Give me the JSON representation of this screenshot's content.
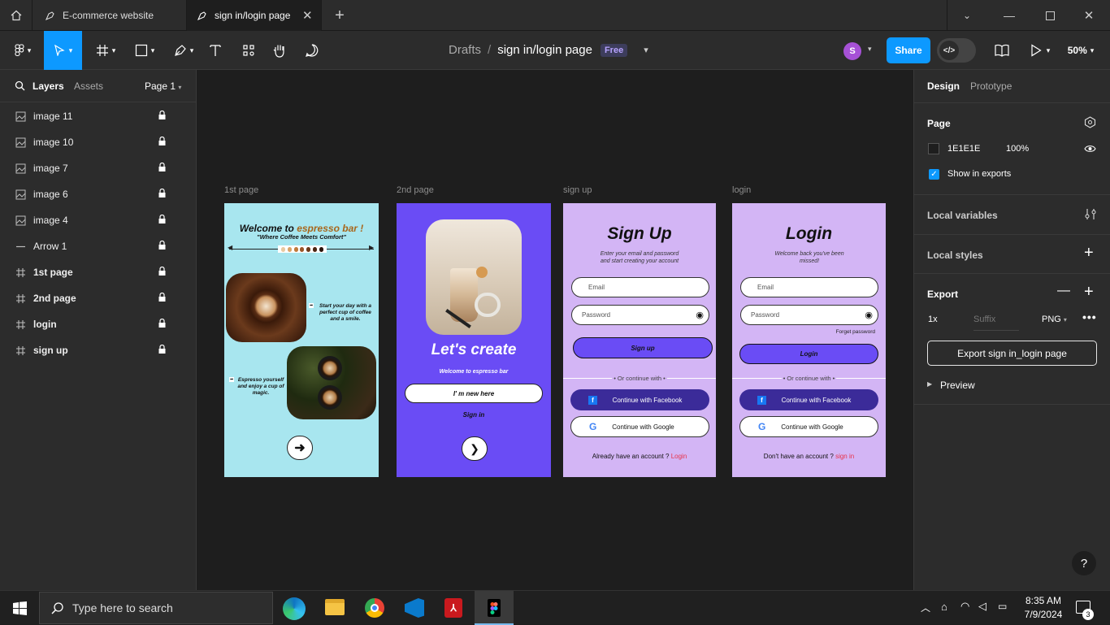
{
  "tabs": [
    {
      "label": "E-commerce website"
    },
    {
      "label": "sign in/login page"
    }
  ],
  "toolbar": {
    "breadcrumb_root": "Drafts",
    "breadcrumb_sep": "/",
    "file_name": "sign in/login page",
    "plan_badge": "Free",
    "avatar_letter": "S",
    "share_label": "Share",
    "zoom": "50%"
  },
  "left_panel": {
    "tab_layers": "Layers",
    "tab_assets": "Assets",
    "page_selector": "Page 1",
    "layers": [
      {
        "name": "image 11",
        "type": "image"
      },
      {
        "name": "image 10",
        "type": "image"
      },
      {
        "name": "image 7",
        "type": "image"
      },
      {
        "name": "image 6",
        "type": "image"
      },
      {
        "name": "image 4",
        "type": "image"
      },
      {
        "name": "Arrow 1",
        "type": "line"
      },
      {
        "name": "1st page",
        "type": "frame"
      },
      {
        "name": "2nd page",
        "type": "frame"
      },
      {
        "name": "login",
        "type": "frame"
      },
      {
        "name": "sign up",
        "type": "frame"
      }
    ]
  },
  "right_panel": {
    "tab_design": "Design",
    "tab_prototype": "Prototype",
    "page_title": "Page",
    "page_color": "1E1E1E",
    "page_opacity": "100%",
    "show_exports": "Show in exports",
    "local_variables": "Local variables",
    "local_styles": "Local styles",
    "export_title": "Export",
    "export_scale": "1x",
    "export_suffix_placeholder": "Suffix",
    "export_format": "PNG",
    "export_button": "Export sign in_login page",
    "preview": "Preview"
  },
  "frames": {
    "first": {
      "label": "1st page",
      "welcome": "Welcome to ",
      "brand": "espresso bar !",
      "tagline": "\"Where Coffee Meets Comfort\"",
      "text1": "Start your day with a perfect cup of coffee and a smile.",
      "text2": "Espresso yourself and enjoy a cup of magic."
    },
    "second": {
      "label": "2nd page",
      "heading": "Let's create",
      "subtitle": "Welcome to espresso bar",
      "new_btn": "I' m new here",
      "sign_in": "Sign in"
    },
    "signup": {
      "label": "sign up",
      "heading": "Sign Up",
      "subtitle": "Enter your email and password and start creating your account",
      "email_placeholder": "Email",
      "password_placeholder": "Password",
      "submit": "Sign up",
      "or": "• Or continue with •",
      "facebook": "Continue with Facebook",
      "google": "Continue with Google",
      "footer": "Already have an account ? ",
      "footer_link": "Login"
    },
    "login": {
      "label": "login",
      "heading": "Login",
      "subtitle": "Welcome back you've been missed!",
      "email_placeholder": "Email",
      "password_placeholder": "Password",
      "forget": "Forget password",
      "submit": "Login",
      "or": "• Or continue with •",
      "facebook": "Continue with Facebook",
      "google": "Continue with Google",
      "footer": "Don't have an account ? ",
      "footer_link": "sign in"
    }
  },
  "taskbar": {
    "search_placeholder": "Type here to search",
    "time": "8:35 AM",
    "date": "7/9/2024",
    "notif_count": "3"
  },
  "colors": {
    "accent": "#0d99ff",
    "cyan_frame": "#a8e6ef",
    "purple_frame": "#6a4cf5",
    "lavender_frame": "#d3b5f5",
    "link_red": "#e8334a",
    "facebook_btn": "#3b2b99"
  }
}
